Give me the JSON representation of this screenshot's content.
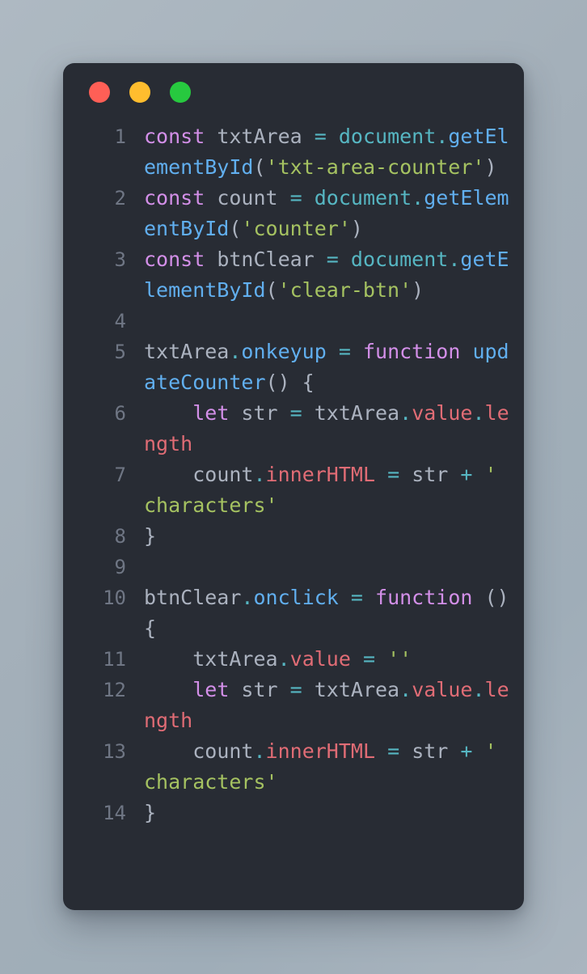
{
  "window": {
    "controls": [
      {
        "name": "close",
        "label": "Close",
        "color": "#ff5f56"
      },
      {
        "name": "minimize",
        "label": "Minimize",
        "color": "#ffbd2e"
      },
      {
        "name": "maximize",
        "label": "Maximize",
        "color": "#27c93f"
      }
    ]
  },
  "theme": {
    "page_background": "#a8b4be",
    "card_background": "#282c34",
    "line_number_color": "#6f7684",
    "default_text": "#abb2bf",
    "keyword": "#d38fe8",
    "object": "#56b6c2",
    "function": "#61afef",
    "string": "#a5c261",
    "property": "#e06c75",
    "operator": "#56b6c2"
  },
  "editor": {
    "language": "javascript",
    "line_count": 14,
    "plain_code": "const txtArea = document.getElementById('txt-area-counter')\nconst count = document.getElementById('counter')\nconst btnClear = document.getElementById('clear-btn')\n\ntxtArea.onkeyup = function updateCounter() {\n    let str = txtArea.value.length\n    count.innerHTML = str + ' characters'\n}\n\nbtnClear.onclick = function (){\n    txtArea.value = ''\n    let str = txtArea.value.length\n    count.innerHTML = str + ' characters'\n}",
    "lines": [
      {
        "number": "1",
        "text": "const txtArea = document.getElementById('txt-area-counter')",
        "tokens": [
          {
            "t": "const",
            "c": "kw"
          },
          {
            "t": " txtArea ",
            "c": "var"
          },
          {
            "t": "=",
            "c": "op"
          },
          {
            "t": " ",
            "c": "var"
          },
          {
            "t": "document",
            "c": "obj"
          },
          {
            "t": ".",
            "c": "op"
          },
          {
            "t": "getElementById",
            "c": "fn"
          },
          {
            "t": "(",
            "c": "punc"
          },
          {
            "t": "'txt-area-counter'",
            "c": "str"
          },
          {
            "t": ")",
            "c": "punc"
          }
        ]
      },
      {
        "number": "2",
        "text": "const count = document.getElementById('counter')",
        "tokens": [
          {
            "t": "const",
            "c": "kw"
          },
          {
            "t": " count ",
            "c": "var"
          },
          {
            "t": "=",
            "c": "op"
          },
          {
            "t": " ",
            "c": "var"
          },
          {
            "t": "document",
            "c": "obj"
          },
          {
            "t": ".",
            "c": "op"
          },
          {
            "t": "getElementById",
            "c": "fn"
          },
          {
            "t": "(",
            "c": "punc"
          },
          {
            "t": "'counter'",
            "c": "str"
          },
          {
            "t": ")",
            "c": "punc"
          }
        ]
      },
      {
        "number": "3",
        "text": "const btnClear = document.getElementById('clear-btn')",
        "tokens": [
          {
            "t": "const",
            "c": "kw"
          },
          {
            "t": " btnClear ",
            "c": "var"
          },
          {
            "t": "=",
            "c": "op"
          },
          {
            "t": " ",
            "c": "var"
          },
          {
            "t": "document",
            "c": "obj"
          },
          {
            "t": ".",
            "c": "op"
          },
          {
            "t": "getElementById",
            "c": "fn"
          },
          {
            "t": "(",
            "c": "punc"
          },
          {
            "t": "'clear-btn'",
            "c": "str"
          },
          {
            "t": ")",
            "c": "punc"
          }
        ]
      },
      {
        "number": "4",
        "text": "",
        "tokens": []
      },
      {
        "number": "5",
        "text": "txtArea.onkeyup = function updateCounter() {",
        "tokens": [
          {
            "t": "txtArea",
            "c": "var"
          },
          {
            "t": ".",
            "c": "op"
          },
          {
            "t": "onkeyup",
            "c": "fn"
          },
          {
            "t": " ",
            "c": "var"
          },
          {
            "t": "=",
            "c": "op"
          },
          {
            "t": " ",
            "c": "var"
          },
          {
            "t": "function",
            "c": "kw"
          },
          {
            "t": " ",
            "c": "var"
          },
          {
            "t": "updateCounter",
            "c": "fn"
          },
          {
            "t": "() {",
            "c": "punc"
          }
        ]
      },
      {
        "number": "6",
        "text": "    let str = txtArea.value.length",
        "tokens": [
          {
            "t": "    ",
            "c": "var"
          },
          {
            "t": "let",
            "c": "kw"
          },
          {
            "t": " str ",
            "c": "var"
          },
          {
            "t": "=",
            "c": "op"
          },
          {
            "t": " txtArea",
            "c": "var"
          },
          {
            "t": ".",
            "c": "op"
          },
          {
            "t": "value",
            "c": "prop"
          },
          {
            "t": ".",
            "c": "op"
          },
          {
            "t": "length",
            "c": "prop"
          }
        ]
      },
      {
        "number": "7",
        "text": "    count.innerHTML = str + ' characters'",
        "tokens": [
          {
            "t": "    count",
            "c": "var"
          },
          {
            "t": ".",
            "c": "op"
          },
          {
            "t": "innerHTML",
            "c": "prop"
          },
          {
            "t": " ",
            "c": "var"
          },
          {
            "t": "=",
            "c": "op"
          },
          {
            "t": " str ",
            "c": "var"
          },
          {
            "t": "+",
            "c": "op"
          },
          {
            "t": " ",
            "c": "var"
          },
          {
            "t": "' characters'",
            "c": "str"
          }
        ]
      },
      {
        "number": "8",
        "text": "}",
        "tokens": [
          {
            "t": "}",
            "c": "punc"
          }
        ]
      },
      {
        "number": "9",
        "text": "",
        "tokens": []
      },
      {
        "number": "10",
        "text": "btnClear.onclick = function (){",
        "tokens": [
          {
            "t": "btnClear",
            "c": "var"
          },
          {
            "t": ".",
            "c": "op"
          },
          {
            "t": "onclick",
            "c": "fn"
          },
          {
            "t": " ",
            "c": "var"
          },
          {
            "t": "=",
            "c": "op"
          },
          {
            "t": " ",
            "c": "var"
          },
          {
            "t": "function",
            "c": "kw"
          },
          {
            "t": " (){",
            "c": "punc"
          }
        ]
      },
      {
        "number": "11",
        "text": "    txtArea.value = ''",
        "tokens": [
          {
            "t": "    txtArea",
            "c": "var"
          },
          {
            "t": ".",
            "c": "op"
          },
          {
            "t": "value",
            "c": "prop"
          },
          {
            "t": " ",
            "c": "var"
          },
          {
            "t": "=",
            "c": "op"
          },
          {
            "t": " ",
            "c": "var"
          },
          {
            "t": "''",
            "c": "str"
          }
        ]
      },
      {
        "number": "12",
        "text": "    let str = txtArea.value.length",
        "tokens": [
          {
            "t": "    ",
            "c": "var"
          },
          {
            "t": "let",
            "c": "kw"
          },
          {
            "t": " str ",
            "c": "var"
          },
          {
            "t": "=",
            "c": "op"
          },
          {
            "t": " txtArea",
            "c": "var"
          },
          {
            "t": ".",
            "c": "op"
          },
          {
            "t": "value",
            "c": "prop"
          },
          {
            "t": ".",
            "c": "op"
          },
          {
            "t": "length",
            "c": "prop"
          }
        ]
      },
      {
        "number": "13",
        "text": "    count.innerHTML = str + ' characters'",
        "tokens": [
          {
            "t": "    count",
            "c": "var"
          },
          {
            "t": ".",
            "c": "op"
          },
          {
            "t": "innerHTML",
            "c": "prop"
          },
          {
            "t": " ",
            "c": "var"
          },
          {
            "t": "=",
            "c": "op"
          },
          {
            "t": " str ",
            "c": "var"
          },
          {
            "t": "+",
            "c": "op"
          },
          {
            "t": " ",
            "c": "var"
          },
          {
            "t": "' characters'",
            "c": "str"
          }
        ]
      },
      {
        "number": "14",
        "text": "}",
        "tokens": [
          {
            "t": "}",
            "c": "punc"
          }
        ]
      }
    ]
  }
}
